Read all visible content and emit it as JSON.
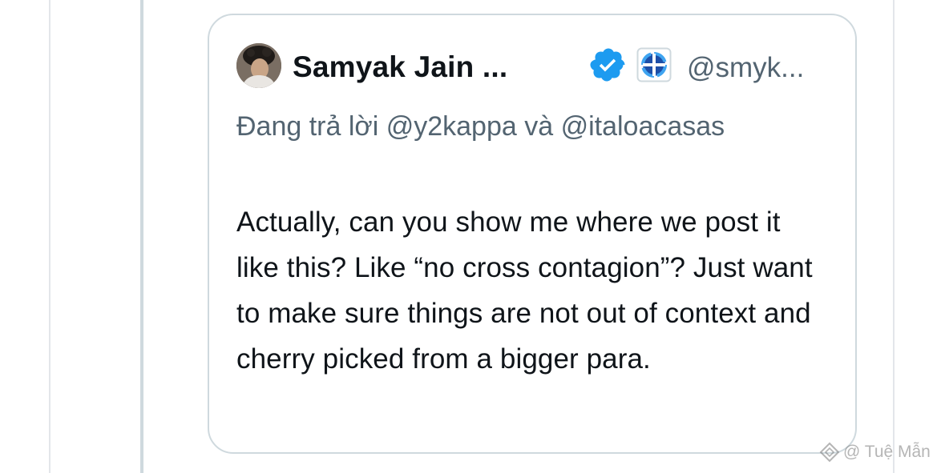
{
  "quoted_tweet": {
    "author": {
      "display_name": "Samyak Jain ...",
      "handle": "@smyk...",
      "verified": true,
      "affiliate_badge_icon": "affiliate-org-icon",
      "avatar_icon": "avatar-photo"
    },
    "reply_context": "Đang trả lời @y2kappa và @italoacasas",
    "text": "Actually, can you show me where we post it like this? Like “no cross contagion”? Just want to make sure things are not out of context and cherry picked from a bigger para."
  },
  "watermark": {
    "text": "@ Tuệ Mẫn",
    "icon": "diamond-logo-icon"
  },
  "colors": {
    "text_primary": "#0f1419",
    "text_secondary": "#536471",
    "border": "#cfd9de",
    "verified_blue": "#1d9bf0"
  }
}
